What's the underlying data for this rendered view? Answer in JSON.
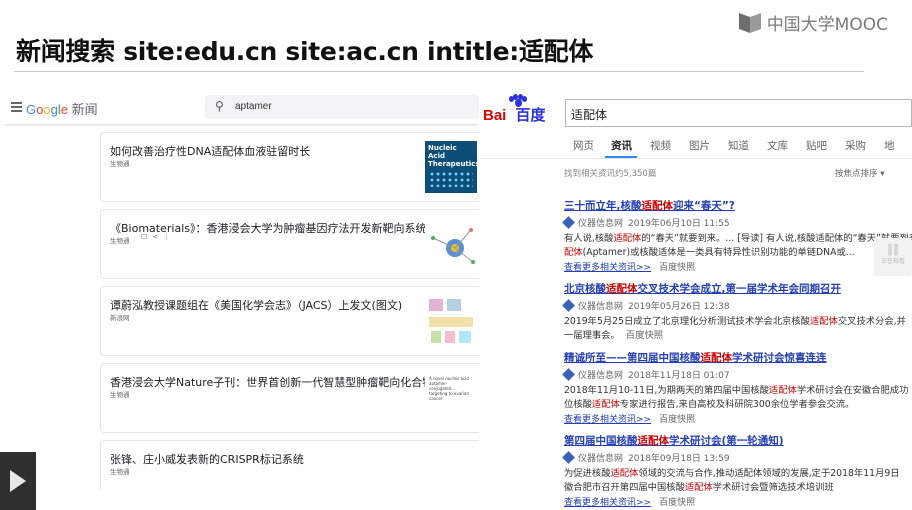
{
  "slide": {
    "title": "新闻搜索 site:edu.cn site:ac.cn  intitle:适配体",
    "brand": "中国大学MOOC"
  },
  "google_news": {
    "logo_google": "Google",
    "logo_news": "新闻",
    "query": "aptamer",
    "cards": [
      {
        "title": "如何改善治疗性DNA适配体血液驻留时长",
        "source": "生物通",
        "thumb": "Nucleic Acid Therapeutics"
      },
      {
        "title": "《Biomaterials》：香港浸会大学为肿瘤基因疗法开发新靶向系统",
        "source": "生物通"
      },
      {
        "title": "谭蔚泓教授课题组在《美国化学会志》（JACS）上发文(图文)",
        "source": "新浪网"
      },
      {
        "title": "香港浸会大学Nature子刊：世界首创新一代智慧型肿瘤靶向化合物",
        "source": "生物通",
        "thumb": "A novel nucleic acid aptamer-conjugated... targeting to ovarian cancer"
      },
      {
        "title": "张锋、庄小威发表新的CRISPR标记系统",
        "source": "生物通"
      }
    ]
  },
  "baidu": {
    "logo_bai": "Bai",
    "logo_du": "百度",
    "query": "适配体",
    "tabs": [
      "网页",
      "资讯",
      "视频",
      "图片",
      "知道",
      "文库",
      "贴吧",
      "采购",
      "地"
    ],
    "result_count": "找到相关资讯约5,350篇",
    "sort": "按焦点排序 ▾",
    "results": [
      {
        "title_pre": "三十而立年,核酸",
        "title_hl": "适配体",
        "title_post": "迎来“春天”?",
        "source": "仪器信息网",
        "date": "2019年06月10日 11:55",
        "abs1_pre": "有人说,核酸",
        "abs1_hl": "适配体",
        "abs1_post": "的“春天”就要到来。... [导读] 有人说,核酸适配体的“春天”就要到来...",
        "abs2_pre": "",
        "abs2_hl": "配体",
        "abs2_post": "(Aptamer)或核酸适体是一类具有特异性识别功能的单链DNA或...",
        "more": "查看更多相关资讯>>",
        "snapshot": "百度快照"
      },
      {
        "title_pre": "北京核酸",
        "title_hl": "适配体",
        "title_post": "交叉技术学会成立,第一届学术年会同期召开",
        "source": "仪器信息网",
        "date": "2019年05月26日 12:38",
        "abs1_pre": "2019年5月25日成立了北京理化分析测试技术学会北京核酸",
        "abs1_hl": "适配体",
        "abs1_post": "交叉技术分会,并",
        "abs2_pre": "一届理事会。",
        "abs2_hl": "",
        "abs2_post": "",
        "more": "",
        "snapshot": "百度快照"
      },
      {
        "title_pre": "精诚所至——第四届中国核酸",
        "title_hl": "适配体",
        "title_post": "学术研讨会惊喜连连",
        "source": "仪器信息网",
        "date": "2018年11月18日 01:07",
        "abs1_pre": "2018年11月10-11日,为期两天的第四届中国核酸",
        "abs1_hl": "适配体",
        "abs1_post": "学术研讨会在安徽合肥成功",
        "abs2_pre": "位核酸",
        "abs2_hl": "适配体",
        "abs2_post": "专家进行报告,来自高校及科研院300余位学者参会交流。",
        "more": "查看更多相关资讯>>",
        "snapshot": "百度快照"
      },
      {
        "title_pre": "第四届中国核酸",
        "title_hl": "适配体",
        "title_post": "学术研讨会(第一轮通知)",
        "source": "仪器信息网",
        "date": "2018年09月18日 13:59",
        "abs1_pre": "为促进核酸",
        "abs1_hl": "适配体",
        "abs1_post": "领域的交流与合作,推动适配体领域的发展,定于2018年11月9日",
        "abs2_pre": "徽合肥市召开第四届中国核酸",
        "abs2_hl": "适配体",
        "abs2_post": "学术研讨会暨筛选技术培训班",
        "more": "查看更多相关资讯>>",
        "snapshot": "百度快照"
      }
    ],
    "widget": "正在观看"
  }
}
